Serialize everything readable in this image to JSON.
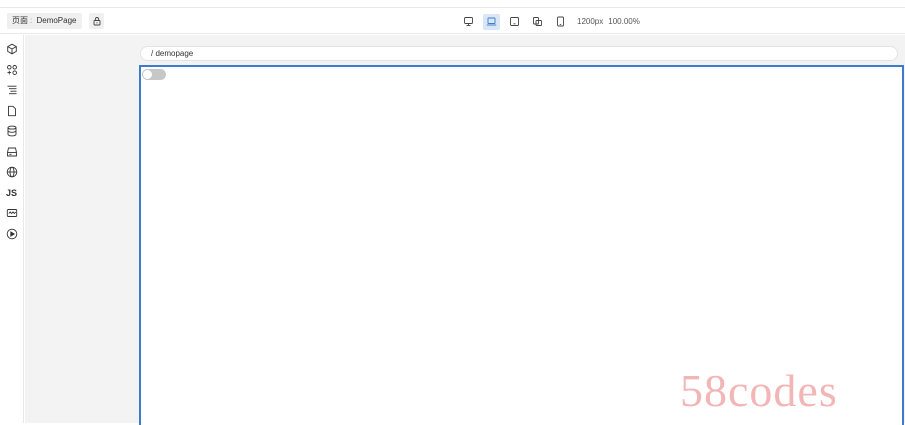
{
  "header": {
    "page_label": "页面",
    "separator": ":",
    "page_name": "DemoPage"
  },
  "devices": [
    {
      "name": "desktop",
      "icon": "monitor-icon",
      "active": false
    },
    {
      "name": "laptop",
      "icon": "laptop-icon",
      "active": true
    },
    {
      "name": "tablet-landscape",
      "icon": "tablet-landscape-icon",
      "active": false
    },
    {
      "name": "tablet-portrait",
      "icon": "tablet-rotate-icon",
      "active": false
    },
    {
      "name": "phone",
      "icon": "phone-icon",
      "active": false
    }
  ],
  "viewport": {
    "width_label": "1200px",
    "zoom_label": "100.00%"
  },
  "sidebar": {
    "tools": [
      {
        "icon": "cube-icon"
      },
      {
        "icon": "components-icon"
      },
      {
        "icon": "outline-tree-icon"
      },
      {
        "icon": "file-icon"
      },
      {
        "icon": "database-icon"
      },
      {
        "icon": "storage-icon"
      },
      {
        "icon": "globe-icon"
      },
      {
        "icon": "js-icon",
        "label": "JS"
      },
      {
        "icon": "wave-icon"
      },
      {
        "icon": "play-icon"
      }
    ]
  },
  "preview": {
    "url": "/ demopage"
  },
  "watermark": {
    "text": "58codes"
  },
  "colors": {
    "accent": "#3d7cc9",
    "active_device_bg": "#d9e6f6",
    "watermark": "#f2b6b6"
  }
}
